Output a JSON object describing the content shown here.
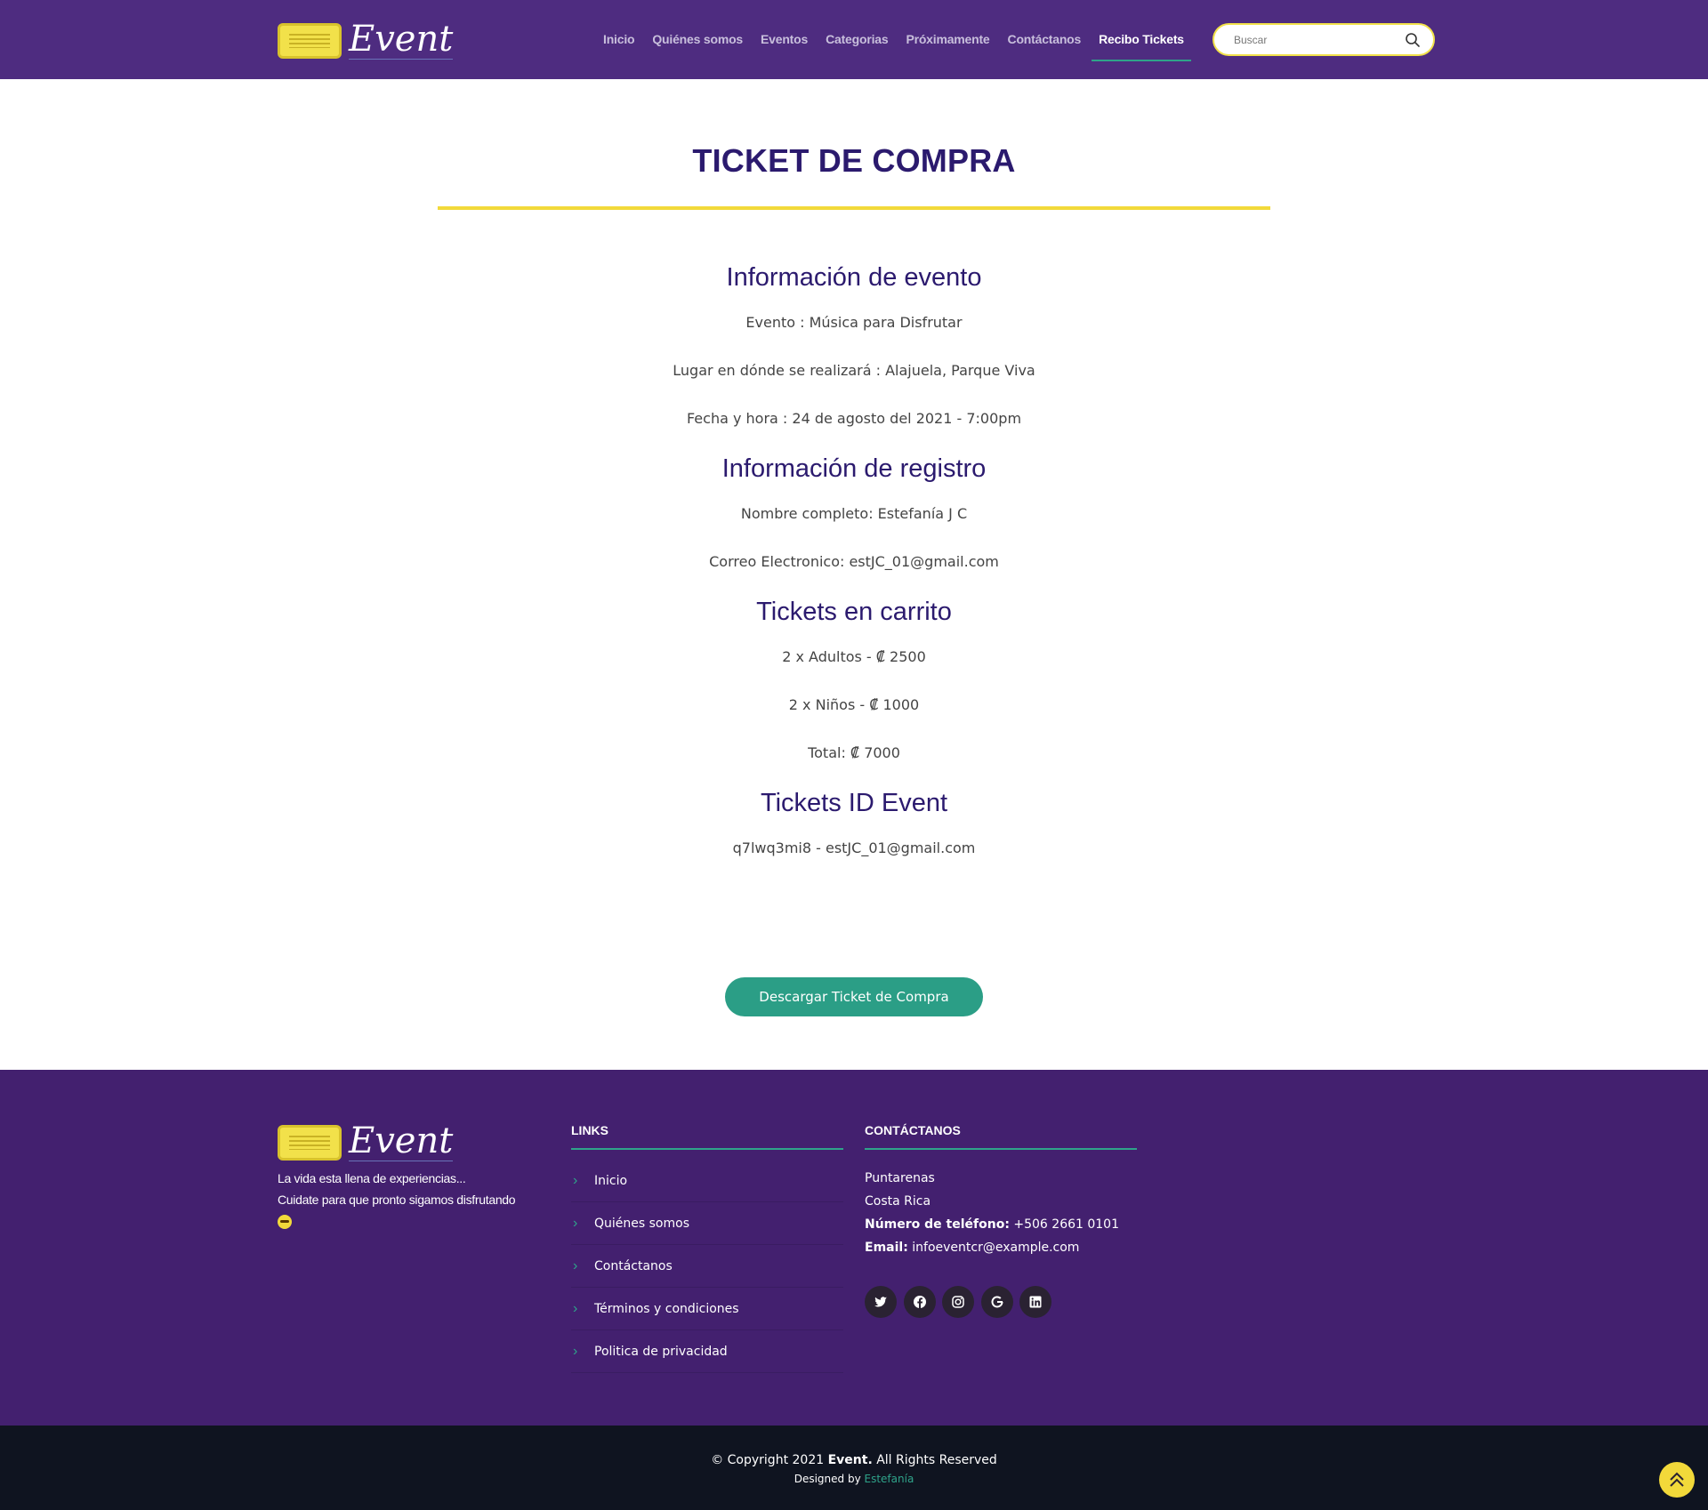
{
  "header": {
    "logo_text": "Event",
    "nav": [
      "Inicio",
      "Quiénes somos",
      "Eventos",
      "Categorias",
      "Próximamente",
      "Contáctanos",
      "Recibo Tickets"
    ],
    "search_placeholder": "Buscar"
  },
  "main": {
    "title": "TICKET DE COMPRA",
    "event_heading": "Información de evento",
    "event_name": "Evento : Música para Disfrutar",
    "event_place": "Lugar en dónde se realizará : Alajuela, Parque Viva",
    "event_date": "Fecha y hora : 24 de agosto del 2021 - 7:00pm",
    "registration_heading": "Información de registro",
    "full_name": "Nombre completo: Estefanía J C",
    "email": "Correo Electronico: estJC_01@gmail.com",
    "cart_heading": "Tickets en carrito",
    "cart_adults": "2 x Adultos - ₡ 2500",
    "cart_kids": "2 x Niños - ₡ 1000",
    "cart_total": "Total: ₡ 7000",
    "ids_heading": "Tickets ID Event",
    "ticket_id": "q7lwq3mi8 - estJC_01@gmail.com",
    "download_label": "Descargar Ticket de Compra"
  },
  "footer": {
    "logo_text": "Event",
    "tagline_1": "La vida esta llena de experiencias...",
    "tagline_2": "Cuidate para que pronto sigamos disfrutando",
    "links_heading": "LINKS",
    "links": [
      "Inicio",
      "Quiénes somos",
      "Contáctanos",
      "Términos y condiciones",
      "Politica de privacidad"
    ],
    "contact_heading": "CONTÁCTANOS",
    "city": "Puntarenas",
    "country": "Costa Rica",
    "phone_label": "Número de teléfono:",
    "phone": "+506 2661 0101",
    "email_label": "Email:",
    "email": "infoeventcr@example.com",
    "social_icons": [
      "twitter-icon",
      "facebook-icon",
      "instagram-icon",
      "google-icon",
      "linkedin-icon"
    ]
  },
  "bottom": {
    "copyright_prefix": "© Copyright 2021",
    "copyright_brand": "Event.",
    "copyright_suffix": "All Rights Reserved",
    "designed_by": "Designed by",
    "designer": "Estefanía"
  },
  "colors": {
    "header_bg": "#4e2c80",
    "footer_bg": "#43206f",
    "title": "#2b1a6e",
    "accent_yellow": "#f2d93a",
    "accent_green": "#2b9e86",
    "bottom_bg": "#0f1420"
  }
}
